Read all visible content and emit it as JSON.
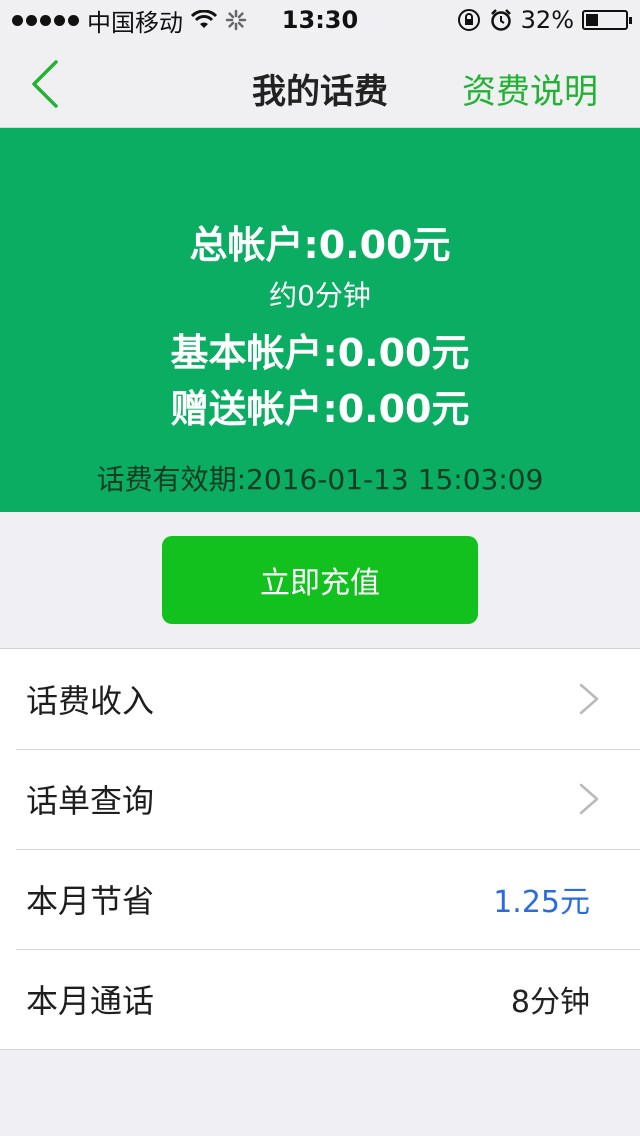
{
  "status": {
    "carrier": "中国移动",
    "time": "13:30",
    "battery": "32%",
    "battery_level": 0.32
  },
  "nav": {
    "title": "我的话费",
    "right_link": "资费说明"
  },
  "balance": {
    "total": "总帐户:0.00元",
    "minutes": "约0分钟",
    "basic": "基本帐户:0.00元",
    "gift": "赠送帐户:0.00元",
    "validity": "话费有效期:2016-01-13 15:03:09"
  },
  "recharge_label": "立即充值",
  "list": {
    "items": [
      {
        "label": "话费收入"
      },
      {
        "label": "话单查询"
      },
      {
        "label": "本月节省",
        "value": "1.25元"
      },
      {
        "label": "本月通话",
        "value": "8分钟"
      }
    ]
  },
  "colors": {
    "brand_green": "#0aad62",
    "button_green": "#12c01e",
    "accent_green": "#21b234",
    "link_blue": "#2a6be0"
  },
  "icons": [
    "signal-dots-icon",
    "wifi-icon",
    "loading-spinner-icon",
    "rotation-lock-icon",
    "alarm-icon",
    "battery-icon",
    "back-chevron-icon",
    "chevron-right-icon"
  ]
}
